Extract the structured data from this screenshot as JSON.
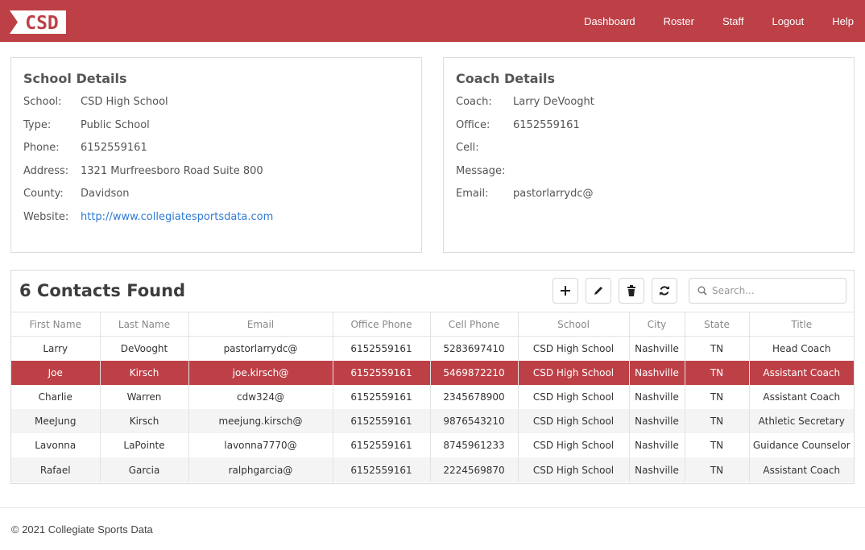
{
  "brand": {
    "logo_text": "CSD",
    "color": "#bd4047"
  },
  "nav": [
    {
      "label": "Dashboard"
    },
    {
      "label": "Roster"
    },
    {
      "label": "Staff"
    },
    {
      "label": "Logout"
    },
    {
      "label": "Help"
    }
  ],
  "school": {
    "title": "School Details",
    "rows": [
      {
        "key": "School:",
        "value": "CSD High School"
      },
      {
        "key": "Type:",
        "value": "Public School"
      },
      {
        "key": "Phone:",
        "value": "6152559161"
      },
      {
        "key": "Address:",
        "value": "1321 Murfreesboro Road Suite 800"
      },
      {
        "key": "County:",
        "value": "Davidson"
      },
      {
        "key": "Website:",
        "value": "http://www.collegiatesportsdata.com"
      }
    ]
  },
  "coach": {
    "title": "Coach Details",
    "rows": [
      {
        "key": "Coach:",
        "value": "Larry DeVooght"
      },
      {
        "key": "Office:",
        "value": "6152559161"
      },
      {
        "key": "Cell:",
        "value": ""
      },
      {
        "key": "Message:",
        "value": ""
      },
      {
        "key": "Email:",
        "value": "pastorlarrydc@"
      }
    ]
  },
  "contacts": {
    "title": "6 Contacts Found",
    "toolbar_icons": [
      "plus-icon",
      "pencil-icon",
      "trash-icon",
      "refresh-icon",
      "search-icon"
    ],
    "search_placeholder": "Search...",
    "columns": [
      "First Name",
      "Last Name",
      "Email",
      "Office Phone",
      "Cell Phone",
      "School",
      "City",
      "State",
      "Title"
    ],
    "rows": [
      [
        "Larry",
        "DeVooght",
        "pastorlarrydc@",
        "6152559161",
        "5283697410",
        "CSD High School",
        "Nashville",
        "TN",
        "Head Coach"
      ],
      [
        "Joe",
        "Kirsch",
        "joe.kirsch@",
        "6152559161",
        "5469872210",
        "CSD High School",
        "Nashville",
        "TN",
        "Assistant Coach"
      ],
      [
        "Charlie",
        "Warren",
        "cdw324@",
        "6152559161",
        "2345678900",
        "CSD High School",
        "Nashville",
        "TN",
        "Assistant Coach"
      ],
      [
        "MeeJung",
        "Kirsch",
        "meejung.kirsch@",
        "6152559161",
        "9876543210",
        "CSD High School",
        "Nashville",
        "TN",
        "Athletic Secretary"
      ],
      [
        "Lavonna",
        "LaPointe",
        "lavonna7770@",
        "6152559161",
        "8745961233",
        "CSD High School",
        "Nashville",
        "TN",
        "Guidance Counselor"
      ],
      [
        "Rafael",
        "Garcia",
        "ralphgarcia@",
        "6152559161",
        "2224569870",
        "CSD High School",
        "Nashville",
        "TN",
        "Assistant Coach"
      ]
    ],
    "selected_row": 1
  },
  "footer": {
    "text": "© 2021 Collegiate Sports Data"
  }
}
